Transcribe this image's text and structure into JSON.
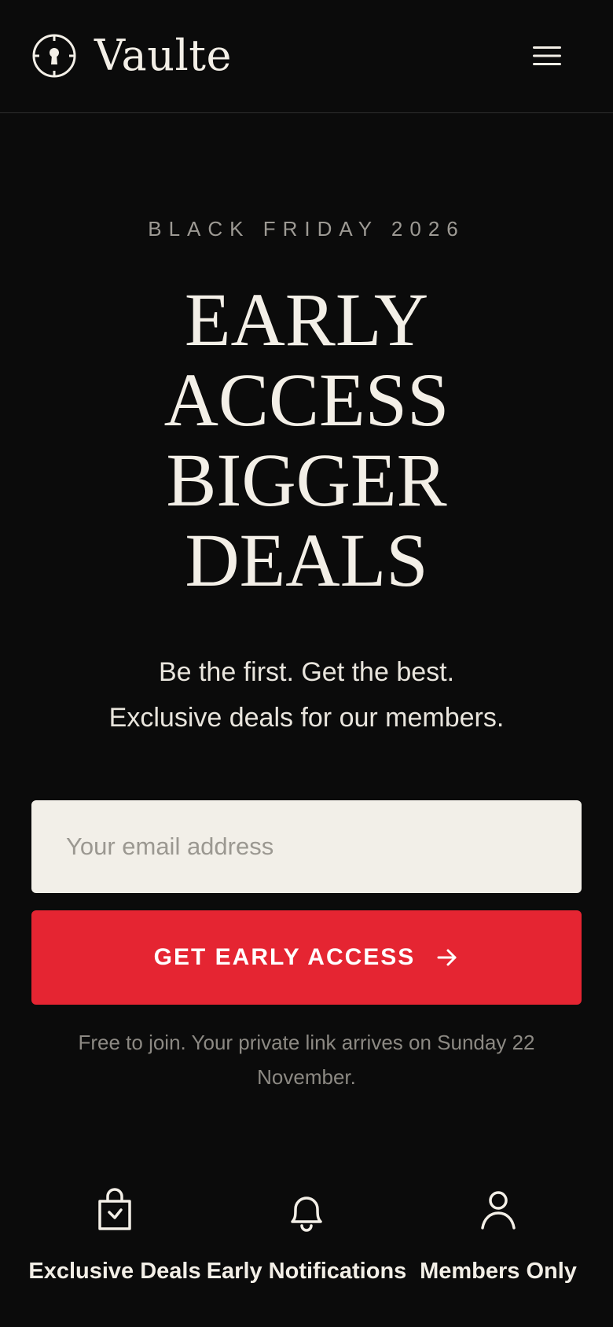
{
  "header": {
    "brand": "Vaulte",
    "logo_icon": "keyhole-icon",
    "menu_icon": "hamburger-menu-icon"
  },
  "hero": {
    "eyebrow": "BLACK FRIDAY 2026",
    "headline_lines": [
      "EARLY",
      "ACCESS",
      "BIGGER",
      "DEALS"
    ],
    "subtext_lines": [
      "Be the first. Get the best.",
      "Exclusive deals for our members."
    ]
  },
  "signup": {
    "email_placeholder": "Your email address",
    "email_value": "",
    "cta_label": "GET EARLY ACCESS",
    "cta_icon": "arrow-right-icon",
    "fineprint": "Free to join. Your private link arrives on Sunday 22 November."
  },
  "features": [
    {
      "label": "Exclusive Deals",
      "icon": "shopping-bag-icon"
    },
    {
      "label": "Early Notifications",
      "icon": "bell-icon"
    },
    {
      "label": "Members Only",
      "icon": "user-icon"
    }
  ],
  "colors": {
    "background": "#0b0b0b",
    "text": "#f3efe7",
    "accent": "#e52532",
    "input_background": "#f2efe8",
    "muted": "#9d9a94"
  }
}
